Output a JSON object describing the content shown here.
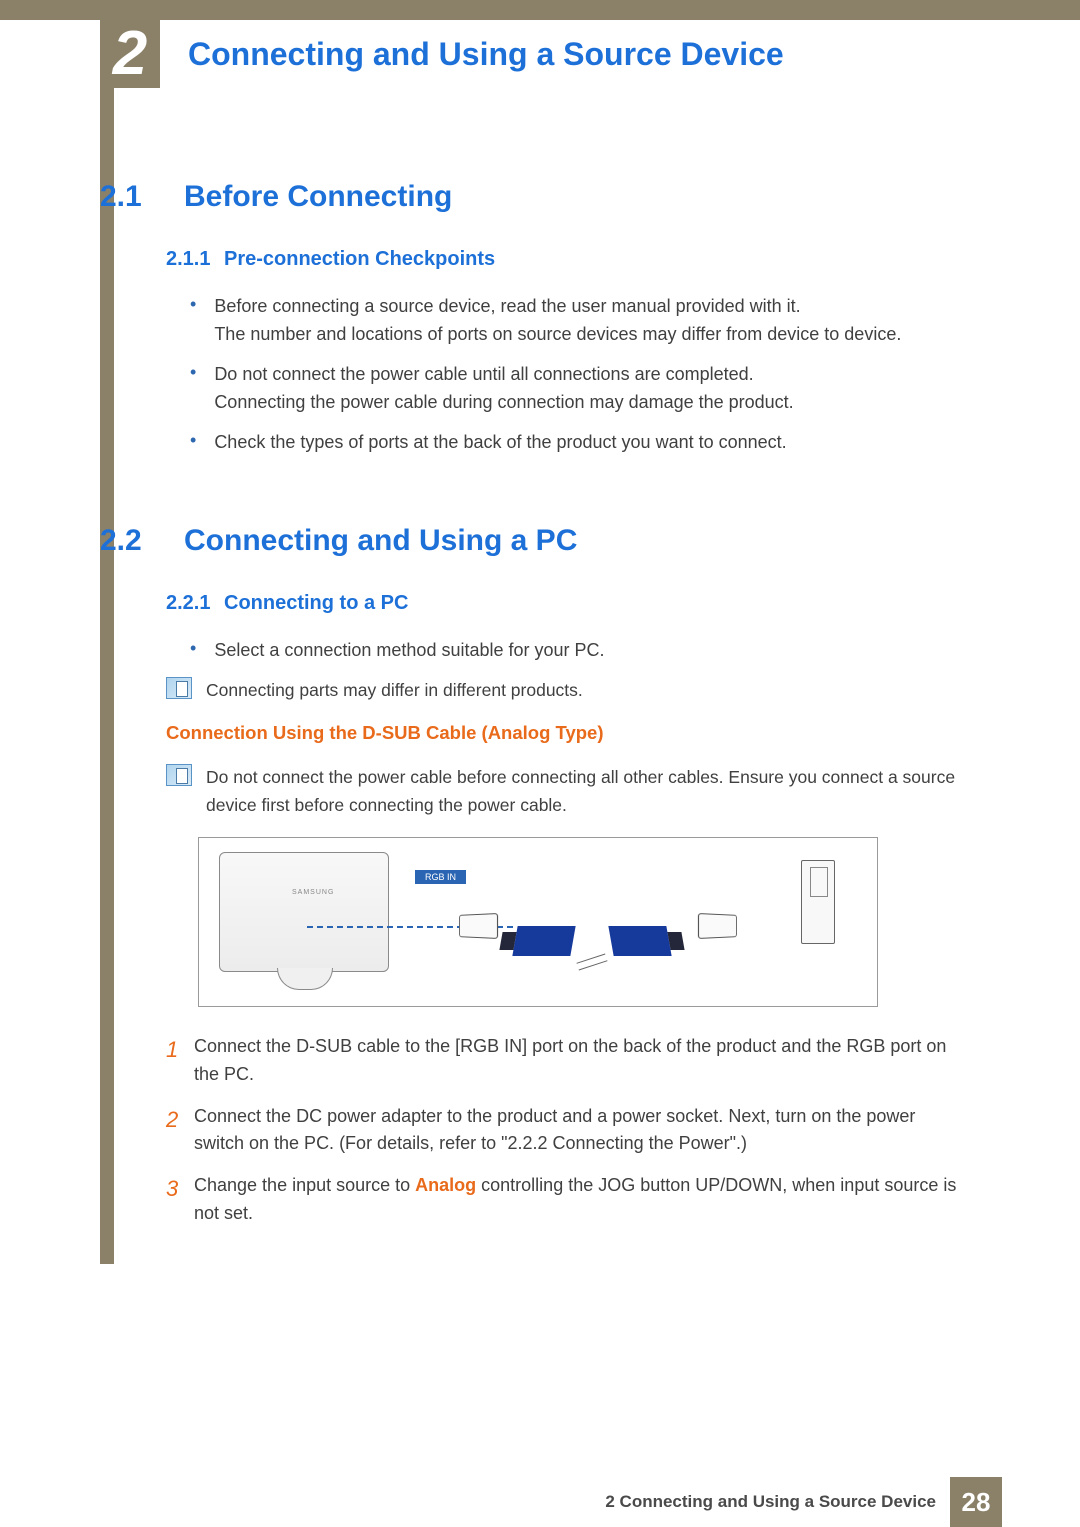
{
  "chapter": {
    "number": "2",
    "title": "Connecting and Using a Source Device"
  },
  "section21": {
    "num": "2.1",
    "title": "Before Connecting",
    "sub": {
      "num": "2.1.1",
      "title": "Pre-connection Checkpoints"
    },
    "bullets": [
      "Before connecting a source device, read the user manual provided with it.\nThe number and locations of ports on source devices may differ from device to device.",
      "Do not connect the power cable until all connections are completed.\nConnecting the power cable during connection may damage the product.",
      "Check the types of ports at the back of the product you want to connect."
    ]
  },
  "section22": {
    "num": "2.2",
    "title": "Connecting and Using a PC",
    "sub": {
      "num": "2.2.1",
      "title": "Connecting to a PC"
    },
    "bullet": "Select a connection method suitable for your PC.",
    "note1": "Connecting parts may differ in different products.",
    "h3": "Connection Using the D-SUB Cable (Analog Type)",
    "note2": "Do not connect the power cable before connecting all other cables. Ensure you connect a source device first before connecting the power cable.",
    "diagram": {
      "monitor_brand": "SAMSUNG",
      "port_label": "RGB IN"
    },
    "steps": {
      "s1": "Connect the D-SUB cable to the [RGB IN] port on the back of the product and the RGB port on the PC.",
      "s2": "Connect the DC power adapter to the product and a power socket. Next, turn on the power switch on the PC. (For details, refer to \"2.2.2    Connecting the Power\".)",
      "s3_a": "Change the input source to ",
      "s3_b": "Analog",
      "s3_c": " controlling the JOG button UP/DOWN, when input source is not set."
    }
  },
  "footer": {
    "chapter_label": "2 Connecting and Using a Source Device",
    "page": "28"
  }
}
